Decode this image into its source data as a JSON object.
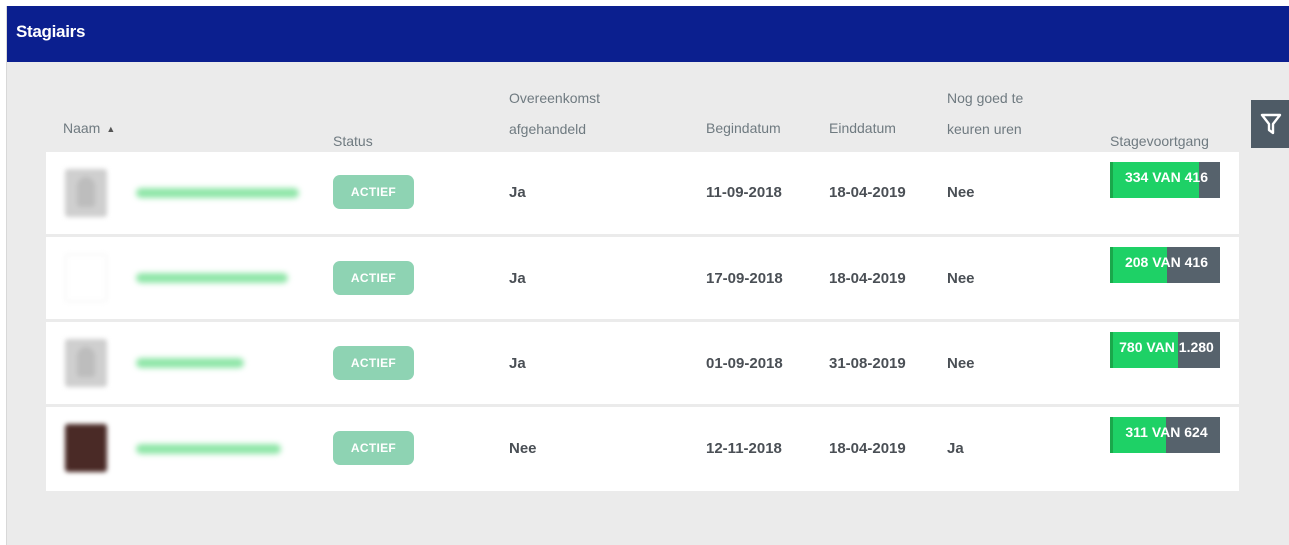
{
  "header": {
    "title": "Stagiairs"
  },
  "columns": {
    "naam": "Naam",
    "status": "Status",
    "overeenkomst_1": "Overeenkomst",
    "overeenkomst_2": "afgehandeld",
    "begindatum": "Begindatum",
    "einddatum": "Einddatum",
    "nog_goed_1": "Nog goed te",
    "nog_goed_2": "keuren uren",
    "stagevoortgang": "Stagevoortgang"
  },
  "icons": {
    "sort": "sort-asc-icon",
    "filter": "filter-icon"
  },
  "colors": {
    "header": "#0b1f8f",
    "badge": "#8ed3b3",
    "progress_fill": "#1ed166",
    "progress_track": "#56626c",
    "name_link": "#8fe6a8"
  },
  "rows": [
    {
      "status": "ACTIEF",
      "overeenkomst": "Ja",
      "begindatum": "11-09-2018",
      "einddatum": "18-04-2019",
      "nog_goed": "Nee",
      "progress_label": "334 VAN 416",
      "progress_fraction": 0.803
    },
    {
      "status": "ACTIEF",
      "overeenkomst": "Ja",
      "begindatum": "17-09-2018",
      "einddatum": "18-04-2019",
      "nog_goed": "Nee",
      "progress_label": "208 VAN 416",
      "progress_fraction": 0.5
    },
    {
      "status": "ACTIEF",
      "overeenkomst": "Ja",
      "begindatum": "01-09-2018",
      "einddatum": "31-08-2019",
      "nog_goed": "Nee",
      "progress_label": "780 VAN 1.280",
      "progress_fraction": 0.609
    },
    {
      "status": "ACTIEF",
      "overeenkomst": "Nee",
      "begindatum": "12-11-2018",
      "einddatum": "18-04-2019",
      "nog_goed": "Ja",
      "progress_label": "311 VAN 624",
      "progress_fraction": 0.498
    }
  ]
}
